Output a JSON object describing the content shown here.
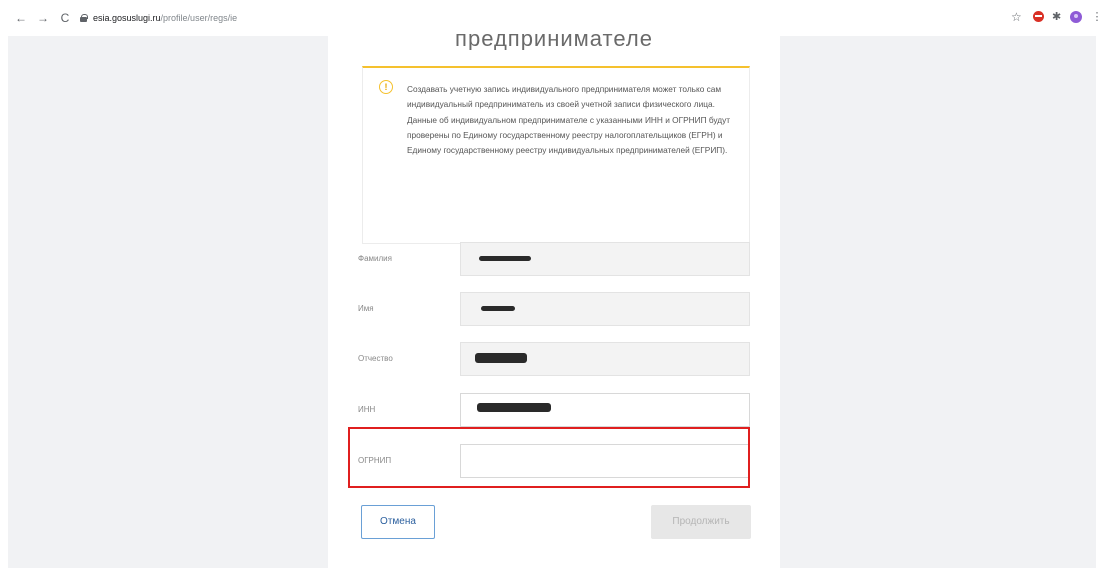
{
  "browser": {
    "url_host": "esia.gosuslugi.ru",
    "url_path": "/profile/user/regs/ie",
    "icons": [
      "back-icon",
      "forward-icon",
      "reload-icon",
      "lock-icon",
      "star-icon",
      "stop-extension-icon",
      "puzzle-icon",
      "profile-avatar-icon",
      "kebab-menu-icon"
    ]
  },
  "page": {
    "heading": "предпринимателе"
  },
  "alert": {
    "icon_glyph": "!",
    "text": "Создавать учетную запись индивидуального предпринимателя может только сам индивидуальный предприниматель из своей учетной записи физического лица. Данные об индивидуальном предпринимателе с указанными ИНН и ОГРНИП будут проверены по Единому государственному реестру налогоплательщиков (ЕГРН) и Единому государственному реестру индивидуальных предпринимателей (ЕГРИП)."
  },
  "form": {
    "fields": [
      {
        "label": "Фамилия",
        "value": ""
      },
      {
        "label": "Имя",
        "value": ""
      },
      {
        "label": "Отчество",
        "value": ""
      },
      {
        "label": "ИНН",
        "value": ""
      },
      {
        "label": "ОГРНИП",
        "value": ""
      }
    ]
  },
  "buttons": {
    "cancel": "Отмена",
    "continue": "Продолжить"
  },
  "colors": {
    "accent_warning": "#f5c12e",
    "highlight_box": "#e01f1f",
    "button_outline": "#6aa0d6"
  }
}
